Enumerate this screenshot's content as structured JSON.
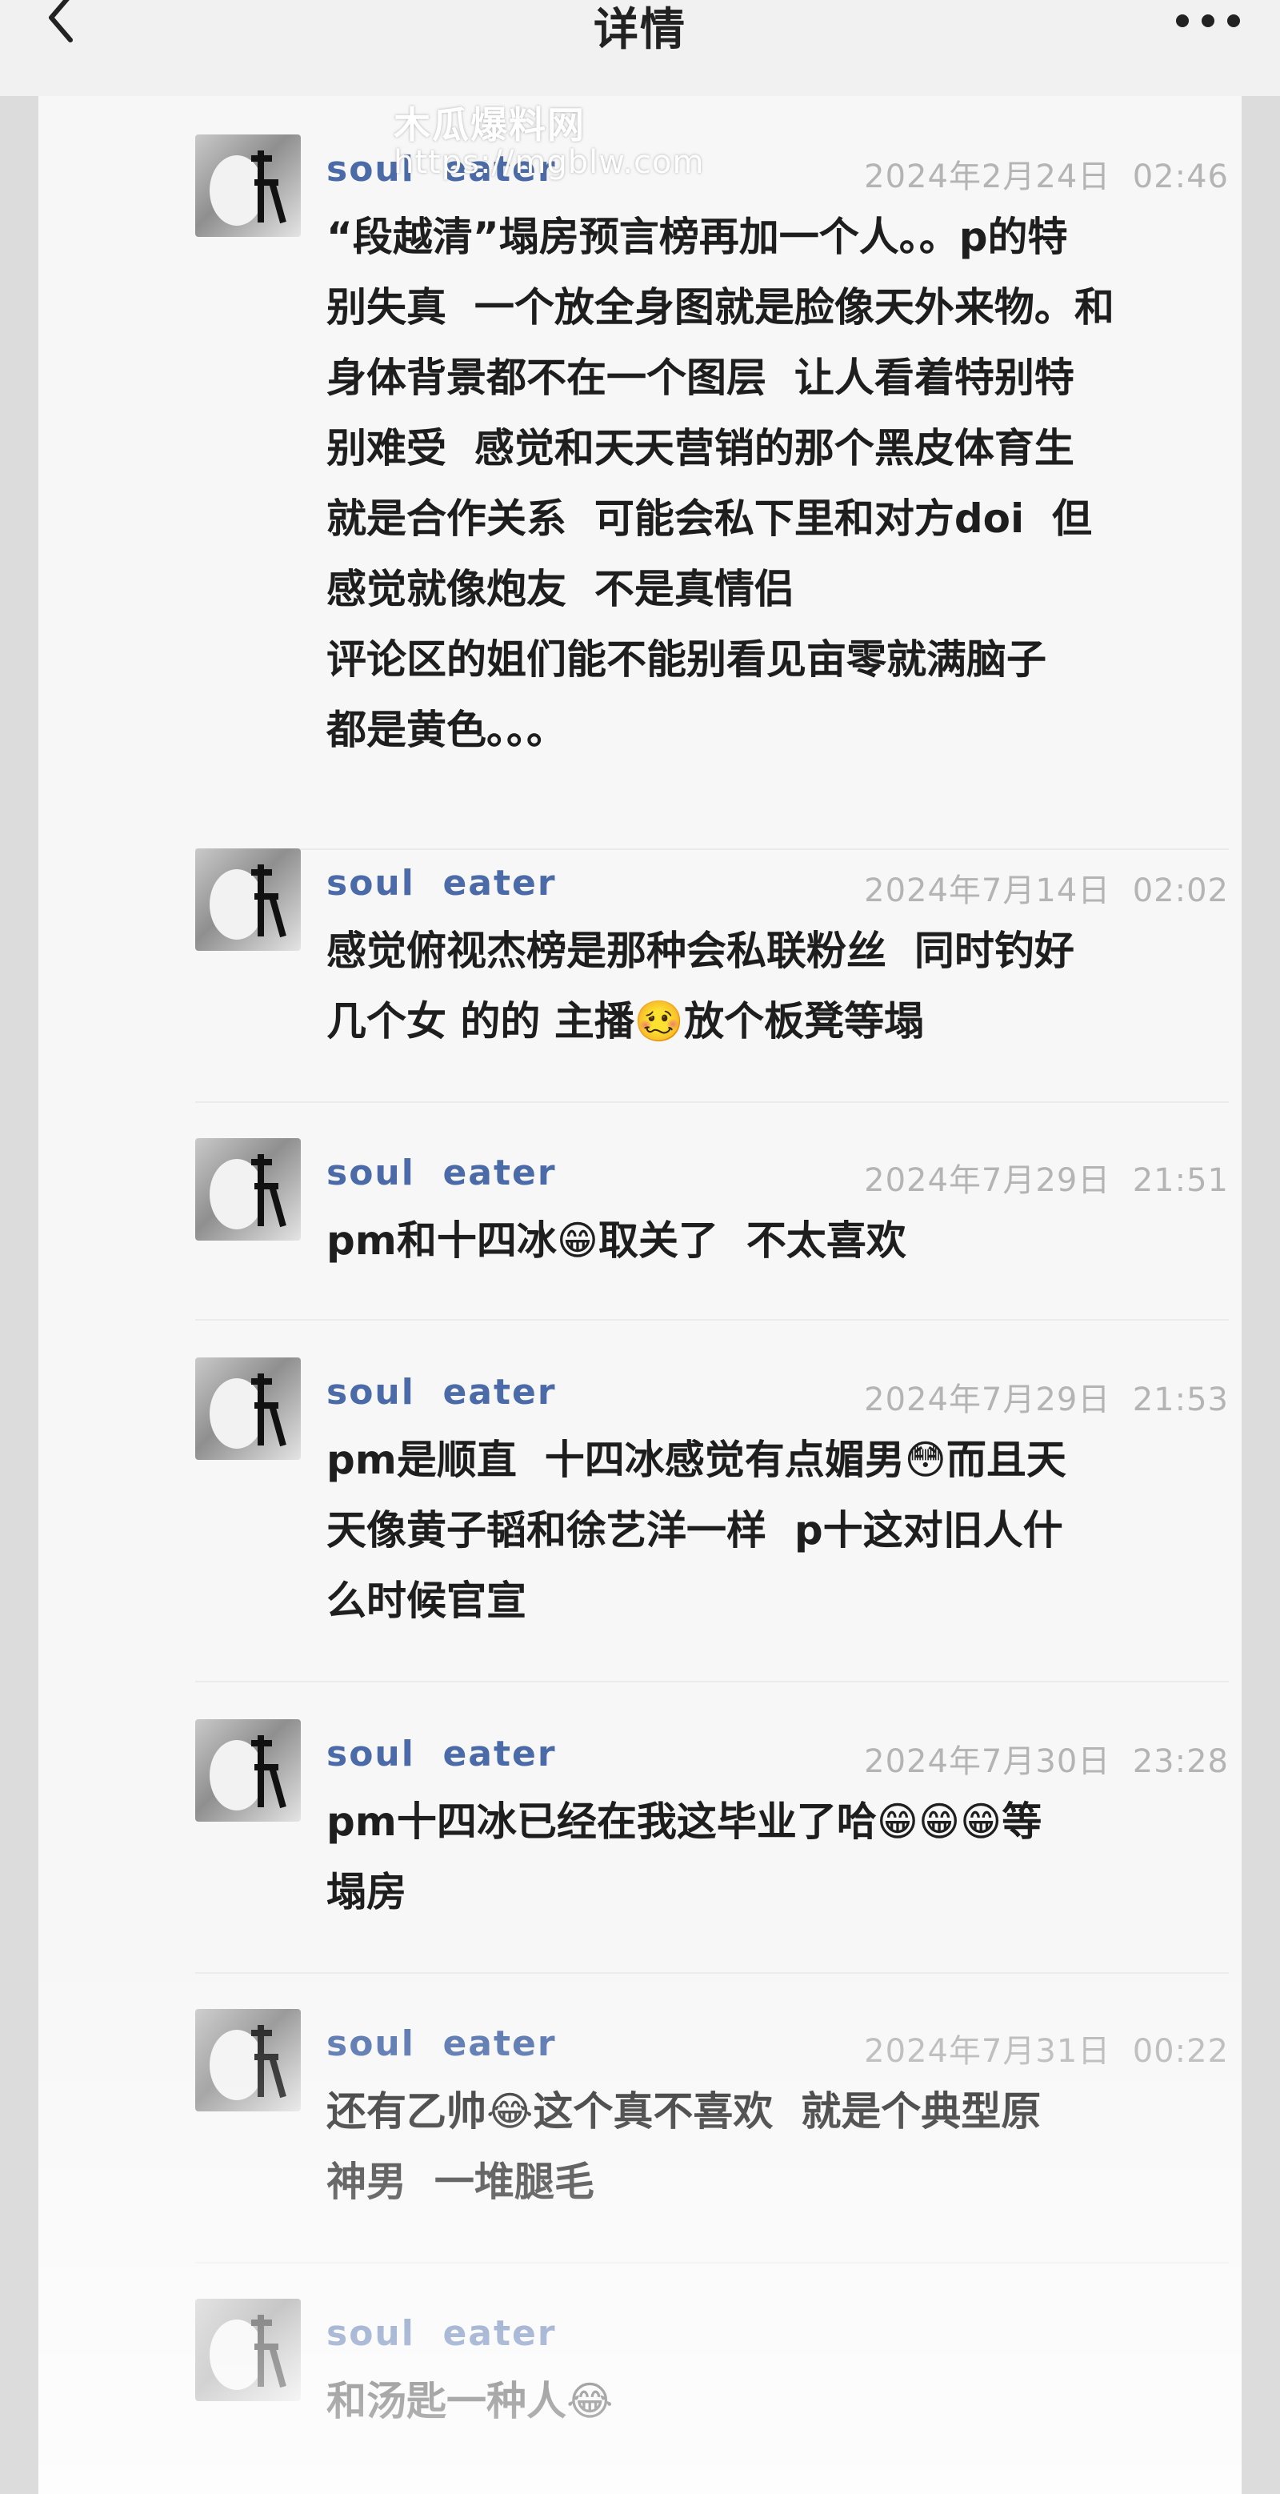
{
  "header": {
    "title": "详情",
    "back_icon": "chevron-left-icon",
    "more_icon": "more-dots-icon"
  },
  "watermark": {
    "name": "木瓜爆料网",
    "url": "https://mgblw.com"
  },
  "comments": [
    {
      "username": "soul  eater",
      "time": "2024年2月24日  02:46",
      "lines": [
        "“段越清”塌房预言榜再加一个人。。p的特",
        "别失真  一个放全身图就是脸像天外来物。和",
        "身体背景都不在一个图层  让人看着特别特",
        "别难受  感觉和天天营销的那个黑皮体育生",
        "就是合作关系  可能会私下里和对方doi  但",
        "感觉就像炮友  不是真情侣",
        "评论区的姐们能不能别看见亩零就满脑子",
        "都是黄色。。。"
      ]
    },
    {
      "username": "soul  eater",
      "time": "2024年7月14日  02:02",
      "lines": [
        "感觉俯视杰榜是那种会私联粉丝  同时钓好",
        "几个女 的的 主播🥴放个板凳等塌"
      ]
    },
    {
      "username": "soul  eater",
      "time": "2024年7月29日  21:51",
      "lines": [
        "pm和十四冰😁取关了  不太喜欢"
      ]
    },
    {
      "username": "soul  eater",
      "time": "2024年7月29日  21:53",
      "lines": [
        "pm是顺直  十四冰感觉有点媚男😳而且天",
        "天像黄子韬和徐艺洋一样  p十这对旧人什",
        "么时候官宣"
      ]
    },
    {
      "username": "soul  eater",
      "time": "2024年7月30日  23:28",
      "lines": [
        "pm十四冰已经在我这毕业了哈😁😁😁等",
        "塌房"
      ]
    },
    {
      "username": "soul  eater",
      "time": "2024年7月31日  00:22",
      "lines": [
        "还有乙帅😂这个真不喜欢  就是个典型原",
        "神男  一堆腿毛"
      ]
    },
    {
      "username": "soul  eater",
      "time": "",
      "lines": [
        "和汤匙一种人😂"
      ]
    }
  ]
}
